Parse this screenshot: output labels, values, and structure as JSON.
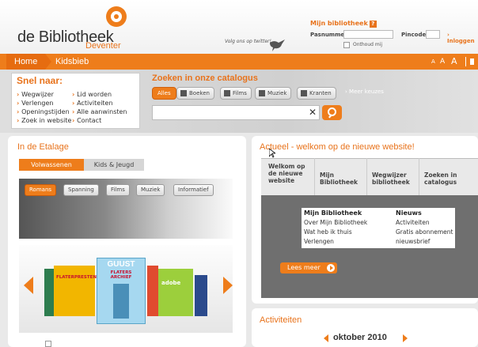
{
  "header": {
    "logo_text": "de Bibliotheek",
    "logo_sub": "Deventer",
    "twitter": "Volg ons op twitter!",
    "mijn_bibliotheek": "Mijn bibliotheek",
    "help_mark": "?",
    "pasnummer_label": "Pasnummer",
    "pincode_label": "Pincode",
    "login_label": "› Inloggen",
    "onthoud_label": "Onthoud mij"
  },
  "nav": {
    "home": "Home",
    "kidsbieb": "Kidsbieb",
    "font_small": "A",
    "font_medium": "A",
    "font_large": "A"
  },
  "snel": {
    "title": "Snel naar:",
    "col1": [
      "Wegwijzer",
      "Verlengen",
      "Openingstijden",
      "Zoek in website"
    ],
    "col2": [
      "Lid worden",
      "Activiteiten",
      "Alle aanwinsten",
      "Contact"
    ]
  },
  "zoek": {
    "title": "Zoeken in onze catalogus",
    "filters": [
      "Alles",
      "Boeken",
      "Films",
      "Muziek",
      "Kranten"
    ],
    "meer": "› Meer keuzes",
    "clear": "✕"
  },
  "etalage": {
    "title": "In de Etalage",
    "tabs": [
      "Volwassenen",
      "Kids & Jeugd"
    ],
    "chips": [
      "Romans",
      "Spanning",
      "Films",
      "Muziek",
      "Informatief"
    ],
    "cover_title_1": "FLATERPRESTEN",
    "cover_title_2": "GUUST",
    "cover_sub_2": "FLATERS ARCHIEF",
    "cover_title_3": "adobe"
  },
  "actueel": {
    "title": "Actueel - welkom op de nieuwe website!",
    "tabs": [
      [
        "Welkom op",
        "de nieuwe",
        "website"
      ],
      [
        "Mijn",
        "Bibliotheek"
      ],
      [
        "Wegwijzer",
        "bibliotheek"
      ],
      [
        "Zoeken in",
        "catalogus"
      ]
    ],
    "menu_col1_title": "Mijn Bibliotheek",
    "menu_col1": [
      "Over Mijn Bibliotheek",
      "Wat heb ik thuis",
      "Verlengen"
    ],
    "menu_col2_title": "Nieuws",
    "menu_col2": [
      "Activiteiten",
      "Gratis abonnement",
      "nieuwsbrief"
    ],
    "lees_meer": "Lees meer"
  },
  "activiteiten": {
    "title": "Activiteiten",
    "month": "oktober 2010"
  },
  "colors": {
    "accent": "#ee7d1b",
    "text": "#333333"
  }
}
